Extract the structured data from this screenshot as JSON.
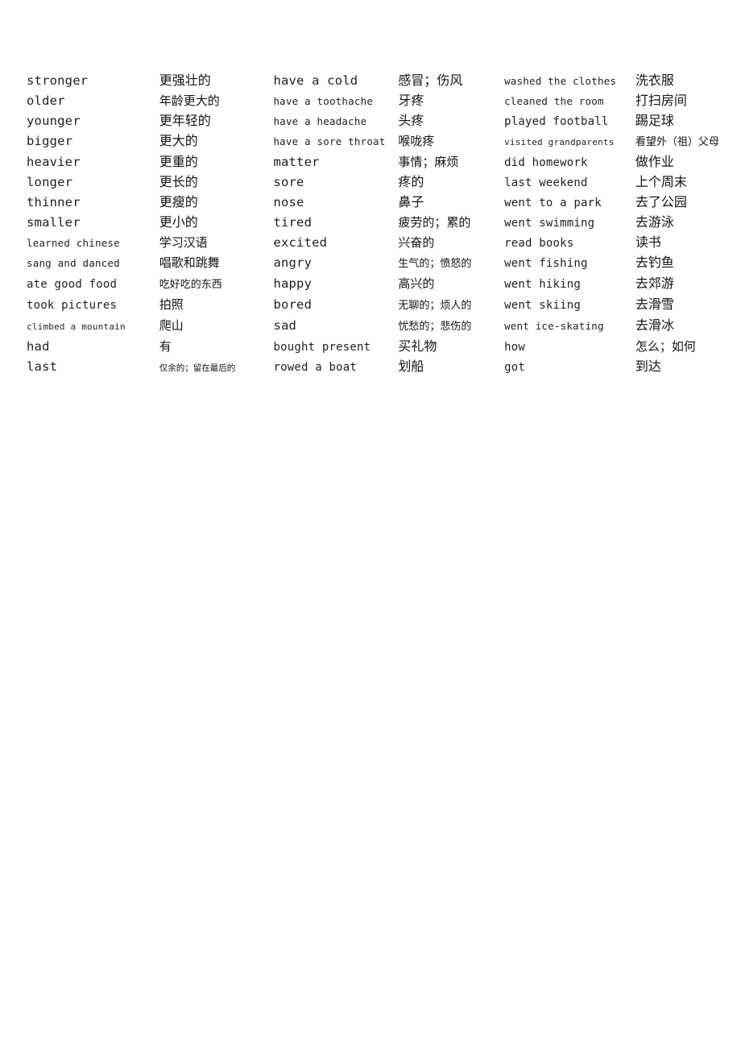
{
  "document": {
    "title": "Vocabulary List",
    "page_background": "#ffffff",
    "text_color": "#1a1a1a",
    "columns": 3,
    "rows": 16
  },
  "rows": [
    {
      "en1": "stronger",
      "zh1": "更强壮的",
      "en2": "have a cold",
      "zh2": "感冒；伤风",
      "en3": "washed the clothes",
      "zh3": "洗衣服",
      "s_en1": "lg",
      "s_zh1": "lg",
      "s_en2": "lg",
      "s_zh2": "lg",
      "s_en3": "sm",
      "s_zh3": "lg"
    },
    {
      "en1": "older",
      "zh1": "年龄更大的",
      "en2": "have a toothache",
      "zh2": "牙疼",
      "en3": "cleaned the room",
      "zh3": "打扫房间",
      "s_en1": "lg",
      "s_zh1": "md",
      "s_en2": "sm",
      "s_zh2": "lg",
      "s_en3": "sm",
      "s_zh3": "lg"
    },
    {
      "en1": "younger",
      "zh1": "更年轻的",
      "en2": "have a headache",
      "zh2": "头疼",
      "en3": "played football",
      "zh3": "踢足球",
      "s_en1": "lg",
      "s_zh1": "lg",
      "s_en2": "sm",
      "s_zh2": "lg",
      "s_en3": "md",
      "s_zh3": "lg"
    },
    {
      "en1": "bigger",
      "zh1": "更大的",
      "en2": "have a sore throat",
      "zh2": "喉咙疼",
      "en3": "visited grandparents",
      "zh3": "看望外（祖）父母",
      "s_en1": "lg",
      "s_zh1": "lg",
      "s_en2": "sm",
      "s_zh2": "md",
      "s_en3": "xs",
      "s_zh3": "sm"
    },
    {
      "en1": "heavier",
      "zh1": "更重的",
      "en2": "matter",
      "zh2": "事情；麻烦",
      "en3": "did homework",
      "zh3": "做作业",
      "s_en1": "lg",
      "s_zh1": "lg",
      "s_en2": "lg",
      "s_zh2": "md",
      "s_en3": "md",
      "s_zh3": "lg"
    },
    {
      "en1": "longer",
      "zh1": "更长的",
      "en2": "sore",
      "zh2": "疼的",
      "en3": "last weekend",
      "zh3": "上个周末",
      "s_en1": "lg",
      "s_zh1": "lg",
      "s_en2": "lg",
      "s_zh2": "lg",
      "s_en3": "md",
      "s_zh3": "lg"
    },
    {
      "en1": "thinner",
      "zh1": "更瘦的",
      "en2": "nose",
      "zh2": "鼻子",
      "en3": "went to a park",
      "zh3": "去了公园",
      "s_en1": "lg",
      "s_zh1": "lg",
      "s_en2": "lg",
      "s_zh2": "lg",
      "s_en3": "md",
      "s_zh3": "lg"
    },
    {
      "en1": "smaller",
      "zh1": "更小的",
      "en2": "tired",
      "zh2": "疲劳的；累的",
      "en3": "went swimming",
      "zh3": "去游泳",
      "s_en1": "lg",
      "s_zh1": "lg",
      "s_en2": "lg",
      "s_zh2": "md",
      "s_en3": "md",
      "s_zh3": "lg"
    },
    {
      "en1": "learned chinese",
      "zh1": "学习汉语",
      "en2": "excited",
      "zh2": "兴奋的",
      "en3": "read books",
      "zh3": "读书",
      "s_en1": "sm",
      "s_zh1": "md",
      "s_en2": "lg",
      "s_zh2": "md",
      "s_en3": "md",
      "s_zh3": "lg"
    },
    {
      "en1": "sang and danced",
      "zh1": "唱歌和跳舞",
      "en2": "angry",
      "zh2": "生气的；愤怒的",
      "en3": "went fishing",
      "zh3": "去钓鱼",
      "s_en1": "sm",
      "s_zh1": "md",
      "s_en2": "lg",
      "s_zh2": "sm",
      "s_en3": "md",
      "s_zh3": "lg"
    },
    {
      "en1": "ate good food",
      "zh1": "吃好吃的东西",
      "en2": "happy",
      "zh2": "高兴的",
      "en3": "went hiking",
      "zh3": "去郊游",
      "s_en1": "md",
      "s_zh1": "sm",
      "s_en2": "lg",
      "s_zh2": "md",
      "s_en3": "md",
      "s_zh3": "lg"
    },
    {
      "en1": "took pictures",
      "zh1": "拍照",
      "en2": "bored",
      "zh2": "无聊的；烦人的",
      "en3": "went skiing",
      "zh3": "去滑雪",
      "s_en1": "md",
      "s_zh1": "md",
      "s_en2": "lg",
      "s_zh2": "sm",
      "s_en3": "md",
      "s_zh3": "lg"
    },
    {
      "en1": "climbed a mountain",
      "zh1": "爬山",
      "en2": "sad",
      "zh2": "忧愁的；悲伤的",
      "en3": "went ice-skating",
      "zh3": "去滑冰",
      "s_en1": "xs",
      "s_zh1": "md",
      "s_en2": "lg",
      "s_zh2": "sm",
      "s_en3": "sm",
      "s_zh3": "lg"
    },
    {
      "en1": "had",
      "zh1": "有",
      "en2": "bought present",
      "zh2": "买礼物",
      "en3": "how",
      "zh3": "怎么；如何",
      "s_en1": "lg",
      "s_zh1": "md",
      "s_en2": "md",
      "s_zh2": "lg",
      "s_en3": "md",
      "s_zh3": "md"
    },
    {
      "en1": "last",
      "zh1": "仅余的；留在最后的",
      "en2": "rowed a boat",
      "zh2": "划船",
      "en3": "got",
      "zh3": "到达",
      "s_en1": "lg",
      "s_zh1": "xs",
      "s_en2": "md",
      "s_zh2": "lg",
      "s_en3": "md",
      "s_zh3": "lg"
    }
  ]
}
